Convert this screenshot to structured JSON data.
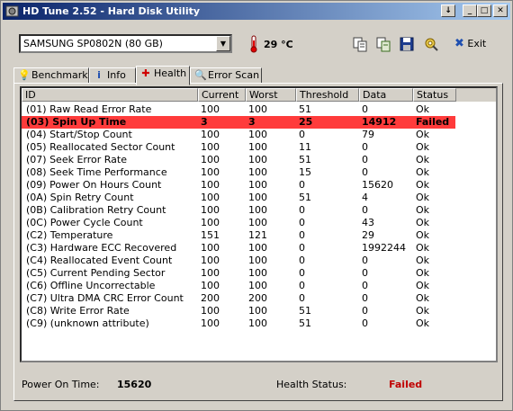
{
  "window": {
    "title": "HD Tune 2.52 - Hard Disk Utility",
    "buttons": {
      "menu": "↓",
      "minimize": "_",
      "maximize": "□",
      "close": "✕"
    }
  },
  "toolbar": {
    "drive": "SAMSUNG SP0802N (80 GB)",
    "temperature": "29 °C",
    "exit_label": "Exit"
  },
  "tabs": [
    {
      "label": "Benchmark",
      "icon": "lightbulb-icon"
    },
    {
      "label": "Info",
      "icon": "info-icon"
    },
    {
      "label": "Health",
      "icon": "health-cross-icon"
    },
    {
      "label": "Error Scan",
      "icon": "magnifier-icon"
    }
  ],
  "table": {
    "headers": [
      "ID",
      "Current",
      "Worst",
      "Threshold",
      "Data",
      "Status"
    ],
    "rows": [
      [
        "(01) Raw Read Error Rate",
        "100",
        "100",
        "51",
        "0",
        "Ok"
      ],
      [
        "(03) Spin Up Time",
        "3",
        "3",
        "25",
        "14912",
        "Failed"
      ],
      [
        "(04) Start/Stop Count",
        "100",
        "100",
        "0",
        "79",
        "Ok"
      ],
      [
        "(05) Reallocated Sector Count",
        "100",
        "100",
        "11",
        "0",
        "Ok"
      ],
      [
        "(07) Seek Error Rate",
        "100",
        "100",
        "51",
        "0",
        "Ok"
      ],
      [
        "(08) Seek Time Performance",
        "100",
        "100",
        "15",
        "0",
        "Ok"
      ],
      [
        "(09) Power On Hours Count",
        "100",
        "100",
        "0",
        "15620",
        "Ok"
      ],
      [
        "(0A) Spin Retry Count",
        "100",
        "100",
        "51",
        "4",
        "Ok"
      ],
      [
        "(0B) Calibration Retry Count",
        "100",
        "100",
        "0",
        "0",
        "Ok"
      ],
      [
        "(0C) Power Cycle Count",
        "100",
        "100",
        "0",
        "43",
        "Ok"
      ],
      [
        "(C2) Temperature",
        "151",
        "121",
        "0",
        "29",
        "Ok"
      ],
      [
        "(C3) Hardware ECC Recovered",
        "100",
        "100",
        "0",
        "1992244",
        "Ok"
      ],
      [
        "(C4) Reallocated Event Count",
        "100",
        "100",
        "0",
        "0",
        "Ok"
      ],
      [
        "(C5) Current Pending Sector",
        "100",
        "100",
        "0",
        "0",
        "Ok"
      ],
      [
        "(C6) Offline Uncorrectable",
        "100",
        "100",
        "0",
        "0",
        "Ok"
      ],
      [
        "(C7) Ultra DMA CRC Error Count",
        "200",
        "200",
        "0",
        "0",
        "Ok"
      ],
      [
        "(C8) Write Error Rate",
        "100",
        "100",
        "51",
        "0",
        "Ok"
      ],
      [
        "(C9) (unknown attribute)",
        "100",
        "100",
        "51",
        "0",
        "Ok"
      ]
    ]
  },
  "footer": {
    "power_on_label": "Power On Time:",
    "power_on_value": "15620",
    "health_label": "Health Status:",
    "health_value": "Failed"
  },
  "colors": {
    "failed_row": "#ff3b3b",
    "failed_text": "#c00000",
    "title_bar": "#0a246a"
  }
}
